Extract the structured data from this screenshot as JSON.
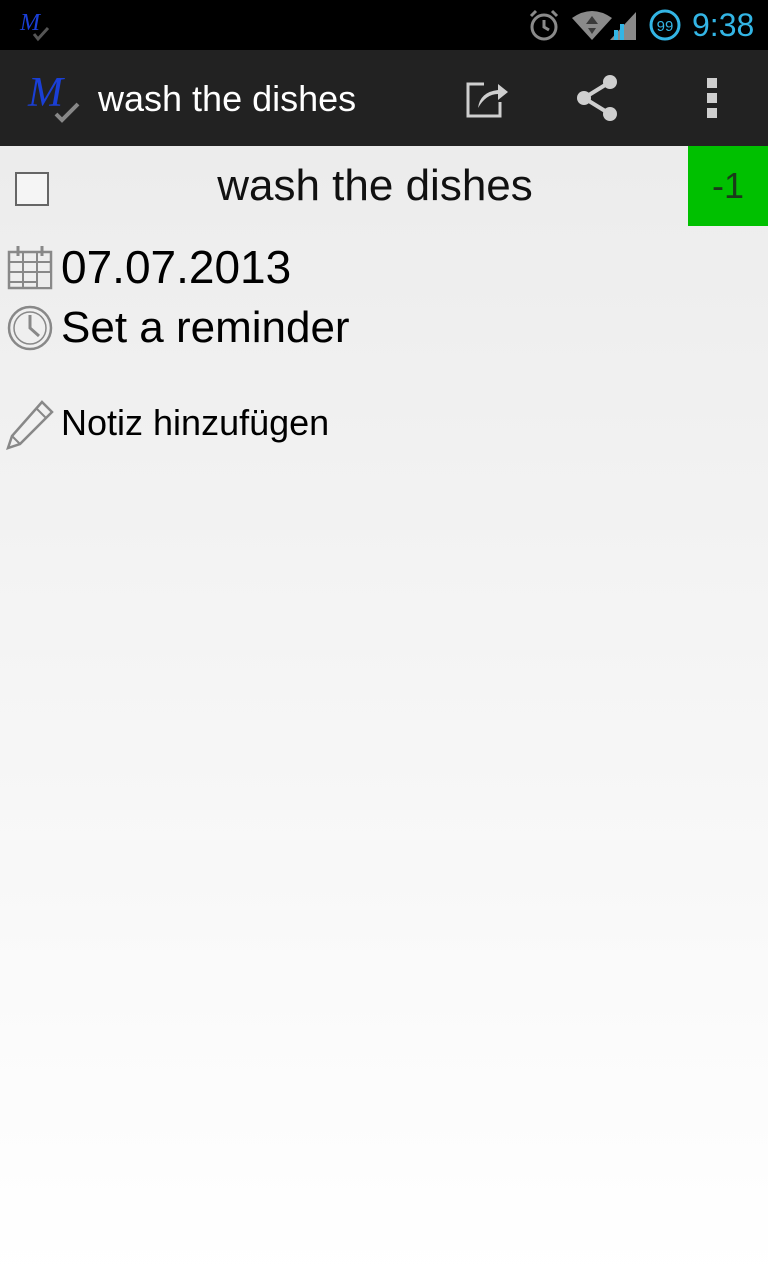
{
  "status_bar": {
    "time": "9:38",
    "battery_level": "99",
    "icons": [
      "app-logo-icon",
      "alarm-icon",
      "wifi-icon",
      "cell-signal-icon",
      "battery-icon"
    ]
  },
  "action_bar": {
    "title": "wash the dishes",
    "logo_text": "M",
    "actions": [
      "edit-icon",
      "share-icon",
      "overflow-menu-icon"
    ]
  },
  "task": {
    "title": "wash the dishes",
    "checked": false,
    "due_badge": "-1",
    "due_badge_color": "#00c000"
  },
  "details": {
    "due_date": "07.07.2013",
    "reminder": "Set a reminder",
    "note": "Notiz hinzufügen"
  },
  "colors": {
    "status_time": "#33b5e5",
    "action_bar_bg": "#222222",
    "logo_blue": "#1a3fd6"
  }
}
